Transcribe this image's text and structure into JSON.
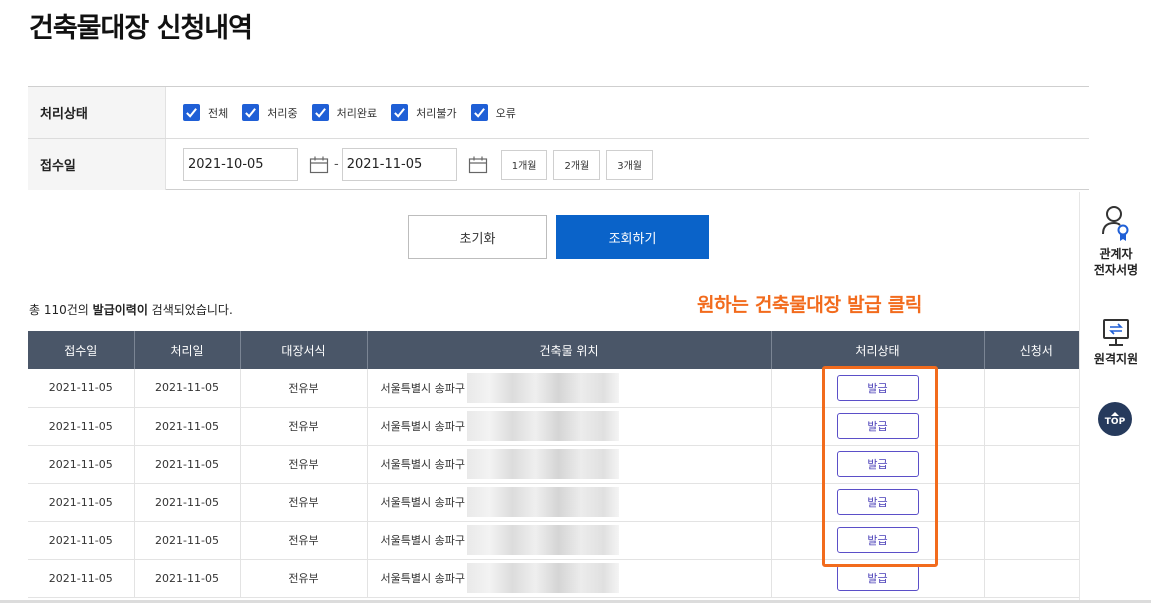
{
  "page": {
    "title": "건축물대장 신청내역"
  },
  "filter": {
    "status_label": "처리상태",
    "status_options": [
      "전체",
      "처리중",
      "처리완료",
      "처리불가",
      "오류"
    ],
    "date_label": "접수일",
    "start_date": "2021-10-05",
    "date_separator": "-",
    "end_date": "2021-11-05",
    "periods": [
      "1개월",
      "2개월",
      "3개월"
    ]
  },
  "actions": {
    "reset_label": "초기화",
    "search_label": "조회하기"
  },
  "results": {
    "summary_prefix": "총 110건의 ",
    "summary_bold": "발급이력이",
    "summary_suffix": " 검색되었습니다."
  },
  "annotation": {
    "text": "원하는 건축물대장 발급 클릭",
    "color": "#f26b1d"
  },
  "table": {
    "headers": [
      "접수일",
      "처리일",
      "대장서식",
      "건축물 위치",
      "처리상태",
      "신청서"
    ],
    "rows": [
      {
        "received": "2021-11-05",
        "processed": "2021-11-05",
        "form": "전유부",
        "location": "서울특별시 송파구",
        "status": "발급",
        "application": ""
      },
      {
        "received": "2021-11-05",
        "processed": "2021-11-05",
        "form": "전유부",
        "location": "서울특별시 송파구",
        "status": "발급",
        "application": ""
      },
      {
        "received": "2021-11-05",
        "processed": "2021-11-05",
        "form": "전유부",
        "location": "서울특별시 송파구",
        "status": "발급",
        "application": ""
      },
      {
        "received": "2021-11-05",
        "processed": "2021-11-05",
        "form": "전유부",
        "location": "서울특별시 송파구",
        "status": "발급",
        "application": ""
      },
      {
        "received": "2021-11-05",
        "processed": "2021-11-05",
        "form": "전유부",
        "location": "서울특별시 송파구",
        "status": "발급",
        "application": ""
      },
      {
        "received": "2021-11-05",
        "processed": "2021-11-05",
        "form": "전유부",
        "location": "서울특별시 송파구",
        "status": "발급",
        "application": ""
      }
    ]
  },
  "sidebar": {
    "item1_line1": "관계자",
    "item1_line2": "전자서명",
    "item1_icon": "user-badge-icon",
    "item2_label": "원격지원",
    "item2_icon": "monitor-icon",
    "top_label": "TOP"
  },
  "colors": {
    "primary": "#0a63c9",
    "checkbox": "#1f5fd6",
    "table_header": "#4a5668",
    "top_button": "#263a5c"
  }
}
